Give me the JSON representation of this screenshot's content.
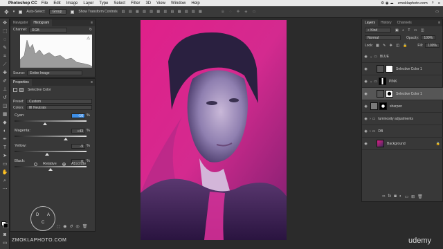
{
  "menubar": {
    "app": "Photoshop CC",
    "items": [
      "File",
      "Edit",
      "Image",
      "Layer",
      "Type",
      "Select",
      "Filter",
      "3D",
      "View",
      "Window",
      "Help"
    ],
    "site": "zmoklaphoto.com"
  },
  "options_bar": {
    "auto_select_label": "Auto-Select:",
    "auto_select_value": "Group",
    "transform_label": "Show Transform Controls"
  },
  "histogram_panel": {
    "tabs": [
      "Navigator",
      "Histogram"
    ],
    "channel_label": "Channel:",
    "channel_value": "RGB",
    "source_label": "Source:",
    "source_value": "Entire Image"
  },
  "properties_panel": {
    "title": "Properties",
    "adjustment_name": "Selective Color",
    "preset_label": "Preset:",
    "preset_value": "Custom",
    "colors_label": "Colors:",
    "colors_value": "Neutrals",
    "sliders": [
      {
        "label": "Cyan:",
        "value": "-16",
        "unit": "%",
        "level": 42
      },
      {
        "label": "Magenta:",
        "value": "+43",
        "unit": "%",
        "level": 71
      },
      {
        "label": "Yellow:",
        "value": "-9",
        "unit": "%",
        "level": 45
      },
      {
        "label": "Black:",
        "value": "0",
        "unit": "%",
        "level": 50
      }
    ],
    "method_relative": "Relative",
    "method_absolute": "Absolute",
    "selected_method": "Absolute"
  },
  "watermark": {
    "logo_letters": [
      "D",
      "A",
      "C"
    ],
    "site": "ZMOKLAPHOTO.COM",
    "brand": "udemy"
  },
  "layers_panel": {
    "tabs": [
      "Layers",
      "History",
      "Channels"
    ],
    "kind_label": "Kind",
    "blend_mode": "Normal",
    "opacity_label": "Opacity:",
    "opacity_value": "100%",
    "lock_label": "Lock:",
    "fill_label": "Fill:",
    "fill_value": "100%",
    "layers": [
      {
        "name": "BLUE",
        "type": "group"
      },
      {
        "name": "Selective Color 1",
        "type": "adjustment"
      },
      {
        "name": "PINK",
        "type": "group"
      },
      {
        "name": "Selective Color 1",
        "type": "adjustment",
        "selected": true
      },
      {
        "name": "sharpen",
        "type": "layer"
      },
      {
        "name": "luminosity adjustments",
        "type": "layer"
      },
      {
        "name": "DB",
        "type": "group"
      },
      {
        "name": "Background",
        "type": "image"
      }
    ]
  },
  "colors": {
    "accent": "#3d8ee6",
    "pink": "#e0208a"
  }
}
